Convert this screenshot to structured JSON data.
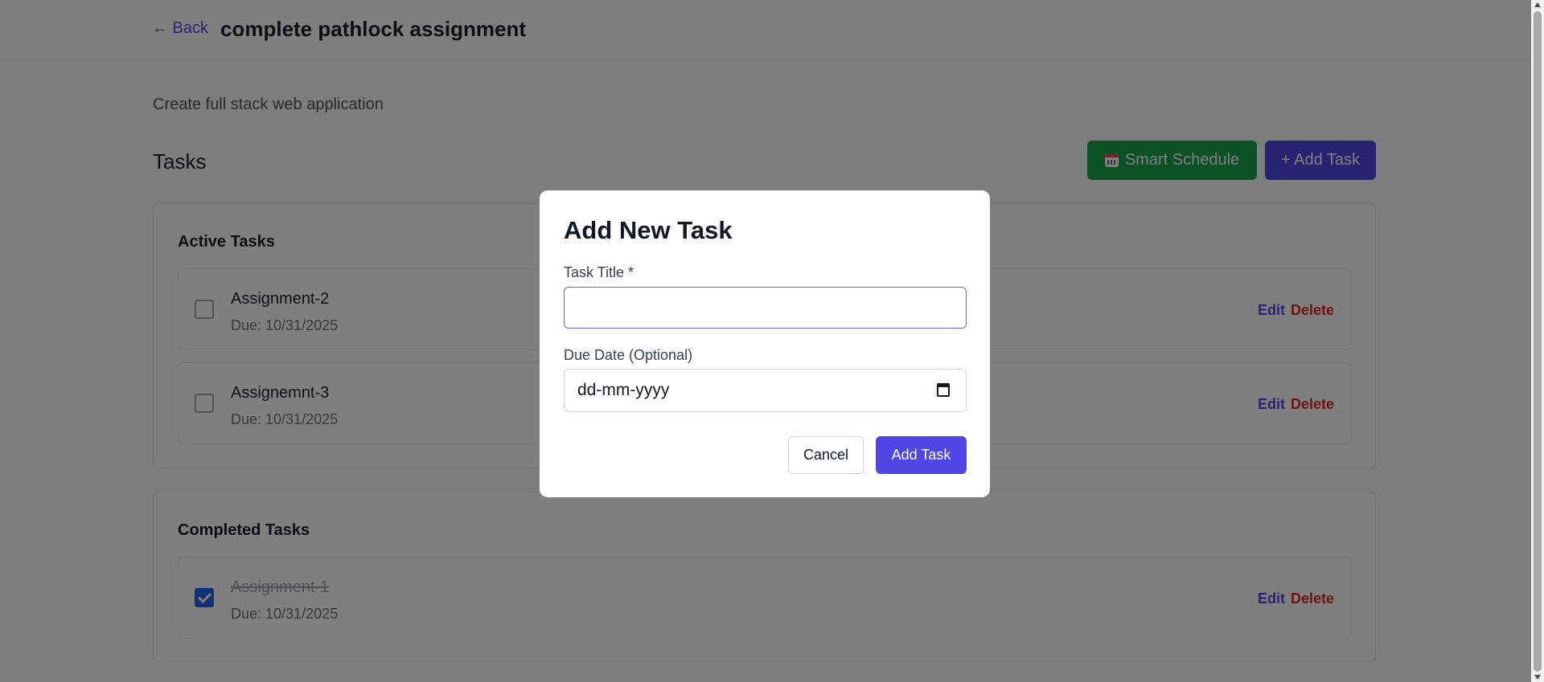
{
  "header": {
    "back_label": "← Back",
    "project_title": "complete pathlock assignment"
  },
  "project": {
    "description": "Create full stack web application"
  },
  "tasks_section": {
    "heading": "Tasks",
    "smart_schedule_label": "Smart Schedule",
    "add_task_label": "+ Add Task"
  },
  "active_tasks": {
    "title": "Active Tasks",
    "items": [
      {
        "name": "Assignment-2",
        "due": "Due: 10/31/2025",
        "edit": "Edit",
        "delete": "Delete",
        "completed": false
      },
      {
        "name": "Assignemnt-3",
        "due": "Due: 10/31/2025",
        "edit": "Edit",
        "delete": "Delete",
        "completed": false
      }
    ]
  },
  "completed_tasks": {
    "title": "Completed Tasks",
    "items": [
      {
        "name": "Assignment-1",
        "due": "Due: 10/31/2025",
        "edit": "Edit",
        "delete": "Delete",
        "completed": true
      }
    ]
  },
  "modal": {
    "title": "Add New Task",
    "task_title_label": "Task Title *",
    "task_title_value": "",
    "due_date_label": "Due Date (Optional)",
    "due_date_placeholder": "dd-mm-yyyy",
    "cancel_label": "Cancel",
    "submit_label": "Add Task"
  },
  "colors": {
    "primary": "#4f46e5",
    "success": "#16a34a",
    "danger": "#dc2626",
    "checkbox_checked": "#2563eb"
  }
}
